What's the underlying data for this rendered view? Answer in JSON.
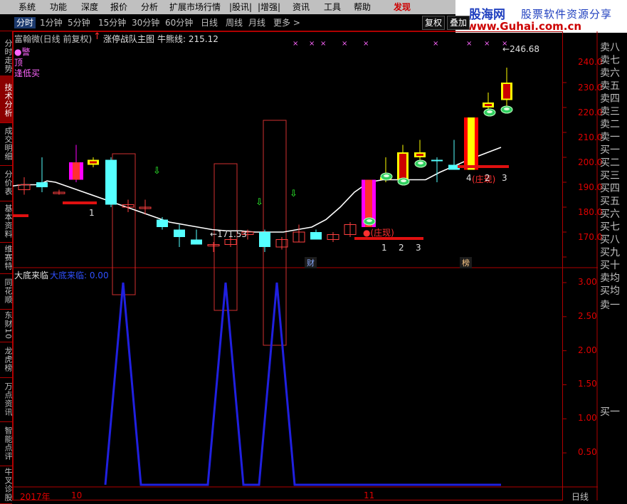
{
  "menu": [
    "系统",
    "功能",
    "深度",
    "报价",
    "分析",
    "扩展市场行情",
    "|股讯|",
    "|增强|",
    "资讯",
    "工具",
    "帮助",
    "发现"
  ],
  "site": {
    "name": "股海网",
    "slogan": "股票软件资源分享",
    "url": "www.Guhai.com.cn"
  },
  "periods": [
    "分时",
    "1分钟",
    "5分钟",
    "15分钟",
    "30分钟",
    "60分钟",
    "日线",
    "周线",
    "月线",
    "更多 >"
  ],
  "toolbar_buttons": [
    "复权",
    "叠加"
  ],
  "left_tabs": [
    "分时走势",
    "技术分析",
    "成交明细",
    "分价表",
    "基本资料",
    "维赛特",
    "同花顺",
    "东财10",
    "龙虎榜",
    "万点资讯",
    "智能点评",
    "牛叉诊股"
  ],
  "main_panel": {
    "stock_name": "富翰微(日线 前复权)",
    "formula": "涨停战队主图",
    "ma_label": "牛熊线: 215.12",
    "legend": [
      "●警",
      "顶",
      "逢低买"
    ],
    "axis": [
      "240.0",
      "230.0",
      "220.0",
      "210.0",
      "200.0",
      "190.0",
      "180.0",
      "170.0"
    ],
    "annotations": {
      "low_price": "171.53",
      "high_price": "246.68",
      "zhuang1": "●(庄现)",
      "zhuang2": "(庄现)",
      "n1": "1",
      "n2": "2",
      "n3": "3",
      "n4": "4",
      "n3b": "3",
      "cai": "财",
      "bang": "榜"
    }
  },
  "sub_panel": {
    "name": "大底来临",
    "value_label": "大底来临: 0.00",
    "axis": [
      "3.00",
      "2.50",
      "2.00",
      "1.50",
      "1.00",
      "0.50"
    ]
  },
  "order_book": [
    "卖八",
    "卖七",
    "卖六",
    "卖五",
    "卖四",
    "卖三",
    "卖二",
    "卖一",
    "买一",
    "买二",
    "买三",
    "买四",
    "买五",
    "买六",
    "买七",
    "买八",
    "买九",
    "买十",
    "卖均",
    "买均",
    "卖一",
    "买一"
  ],
  "date_axis": {
    "year": "2017年",
    "month1": "10",
    "month2": "11",
    "period": "日线"
  },
  "chart_data": {
    "type": "candlestick",
    "price_axis": {
      "min": 165,
      "max": 250
    },
    "ma_line": [
      198.5,
      199,
      199,
      199,
      200.5,
      200,
      198,
      196,
      194,
      192,
      190,
      188,
      186,
      184,
      183,
      182,
      181,
      180.5,
      180.5,
      180,
      180,
      180,
      181,
      182,
      185,
      190,
      196,
      200,
      201,
      201,
      201,
      201,
      204,
      209,
      214
    ],
    "candles": [
      {
        "o": 199,
        "c": 197,
        "h": 202,
        "l": 195,
        "color": "#ff4040"
      },
      {
        "o": 198,
        "c": 200,
        "h": 210,
        "l": 196,
        "color": "#55ffff"
      },
      {
        "o": 196,
        "c": 196,
        "h": 197,
        "l": 195,
        "color": "#ff4040"
      },
      {
        "o": 201,
        "c": 208,
        "h": 215,
        "l": 200,
        "color": "#ff00ff"
      },
      {
        "o": 209,
        "c": 207,
        "h": 210,
        "l": 206,
        "color": "#ffff00"
      },
      {
        "o": 209,
        "c": 191,
        "h": 210,
        "l": 190,
        "color": "#55ffff"
      },
      {
        "o": 190,
        "c": 191,
        "h": 193,
        "l": 188,
        "color": "#ff4040"
      },
      {
        "o": 190,
        "c": 190,
        "h": 193,
        "l": 187,
        "color": "#ff4040"
      },
      {
        "o": 185,
        "c": 182,
        "h": 186,
        "l": 181,
        "color": "#55ffff"
      },
      {
        "o": 181,
        "c": 178,
        "h": 183,
        "l": 174,
        "color": "#55ffff"
      },
      {
        "o": 177,
        "c": 175,
        "h": 181,
        "l": 175,
        "color": "#55ffff"
      },
      {
        "o": 175,
        "c": 175,
        "h": 176,
        "l": 172,
        "color": "#ff4040"
      },
      {
        "o": 175,
        "c": 177,
        "h": 178,
        "l": 174,
        "color": "#ff4040"
      },
      {
        "o": 179,
        "c": 180,
        "h": 181,
        "l": 177,
        "color": "#ff4040"
      },
      {
        "o": 180,
        "c": 174,
        "h": 181,
        "l": 172,
        "color": "#55ffff"
      },
      {
        "o": 174,
        "c": 177,
        "h": 178,
        "l": 173,
        "color": "#ff4040"
      },
      {
        "o": 176,
        "c": 180,
        "h": 183,
        "l": 176,
        "color": "#ff4040"
      },
      {
        "o": 180,
        "c": 177,
        "h": 181,
        "l": 177,
        "color": "#55ffff"
      },
      {
        "o": 177,
        "c": 179,
        "h": 180,
        "l": 176,
        "color": "#ff4040"
      },
      {
        "o": 179,
        "c": 183,
        "h": 184,
        "l": 178,
        "color": "#ff4040"
      },
      {
        "o": 182,
        "c": 201,
        "h": 201,
        "l": 182,
        "color": "#ff00ff"
      },
      {
        "o": 201,
        "c": 202,
        "h": 210,
        "l": 200,
        "color": "#ffff00"
      },
      {
        "o": 201,
        "c": 212,
        "h": 215,
        "l": 201,
        "color": "#ffff00"
      },
      {
        "o": 210,
        "c": 212,
        "h": 217,
        "l": 209,
        "color": "#ffff00"
      },
      {
        "o": 209,
        "c": 209,
        "h": 210,
        "l": 200,
        "color": "#55ffff"
      },
      {
        "o": 207,
        "c": 205,
        "h": 217,
        "l": 205,
        "color": "#55ffff"
      },
      {
        "o": 205,
        "c": 226,
        "h": 226,
        "l": 205,
        "color": "#ff0000"
      },
      {
        "o": 230,
        "c": 232,
        "h": 236,
        "l": 229,
        "color": "#ffff00"
      },
      {
        "o": 233,
        "c": 240,
        "h": 246,
        "l": 230,
        "color": "#ffff00"
      }
    ],
    "spikes": [
      0,
      0,
      0,
      0,
      3,
      0,
      0,
      0,
      0,
      0,
      0,
      3,
      0,
      3,
      0,
      0,
      0,
      0,
      0,
      0,
      0,
      0,
      0,
      0,
      0,
      0,
      0,
      0,
      0
    ],
    "sub_axis": {
      "min": 0,
      "max": 3.2
    }
  }
}
